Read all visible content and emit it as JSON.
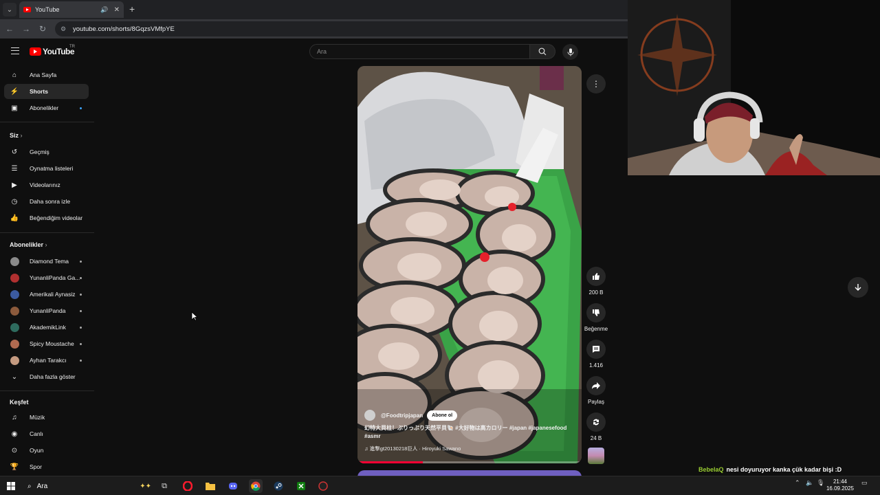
{
  "browser": {
    "tab_title": "YouTube",
    "url": "youtube.com/shorts/8GqzsVMfpYE"
  },
  "youtube": {
    "logo_text": "YouTube",
    "country": "TR",
    "search_placeholder": "Ara",
    "sidebar": {
      "main": [
        {
          "label": "Ana Sayfa",
          "icon": "home-icon"
        },
        {
          "label": "Shorts",
          "icon": "shorts-icon",
          "active": true
        },
        {
          "label": "Abonelikler",
          "icon": "subscriptions-icon"
        }
      ],
      "you_header": "Siz",
      "you": [
        {
          "label": "Geçmiş",
          "icon": "history-icon"
        },
        {
          "label": "Oynatma listeleri",
          "icon": "playlist-icon"
        },
        {
          "label": "Videolarınız",
          "icon": "your-videos-icon"
        },
        {
          "label": "Daha sonra izle",
          "icon": "watch-later-icon"
        },
        {
          "label": "Beğendiğim videolar",
          "icon": "liked-icon"
        }
      ],
      "subs_header": "Abonelikler",
      "subs": [
        {
          "label": "Diamond Tema",
          "color": "#8a8a8a"
        },
        {
          "label": "YunanliPanda Ga...",
          "color": "#b03030"
        },
        {
          "label": "Amerikali Aynasiz",
          "color": "#3b5aa0"
        },
        {
          "label": "YunanliPanda",
          "color": "#8b5a3c"
        },
        {
          "label": "AkademikLink",
          "color": "#2e6b5e"
        },
        {
          "label": "Spicy Moustache",
          "color": "#b06a50"
        },
        {
          "label": "Ayhan Tarakcı",
          "color": "#c49a80"
        }
      ],
      "show_more": "Daha fazla göster",
      "explore_header": "Keşfet",
      "explore": [
        {
          "label": "Müzik",
          "icon": "music-icon"
        },
        {
          "label": "Canlı",
          "icon": "live-icon"
        },
        {
          "label": "Oyun",
          "icon": "gaming-icon"
        },
        {
          "label": "Spor",
          "icon": "sports-icon"
        }
      ]
    },
    "short": {
      "channel": "@Foodtripjapan",
      "subscribe": "Abone ol",
      "description": "幻特大貝柱！ぷりっぷり天然平貝🐚 #大好物は高カロリー #japan #japanesefood #asmr",
      "music": "♫ 進撃gt20130218巨人 · Hiroyuki Sawano",
      "progress": 0.29
    },
    "actions": {
      "likes": "200 B",
      "dislike": "Beğenme",
      "comments": "1.416",
      "share": "Paylaş",
      "remix": "24 B"
    }
  },
  "chat": {
    "user": "BebelaQ",
    "message": "nesi doyuruyor kanka çük kadar bişi :D"
  },
  "taskbar": {
    "search": "Ara",
    "time": "21:44",
    "date": "16.09.2025"
  }
}
